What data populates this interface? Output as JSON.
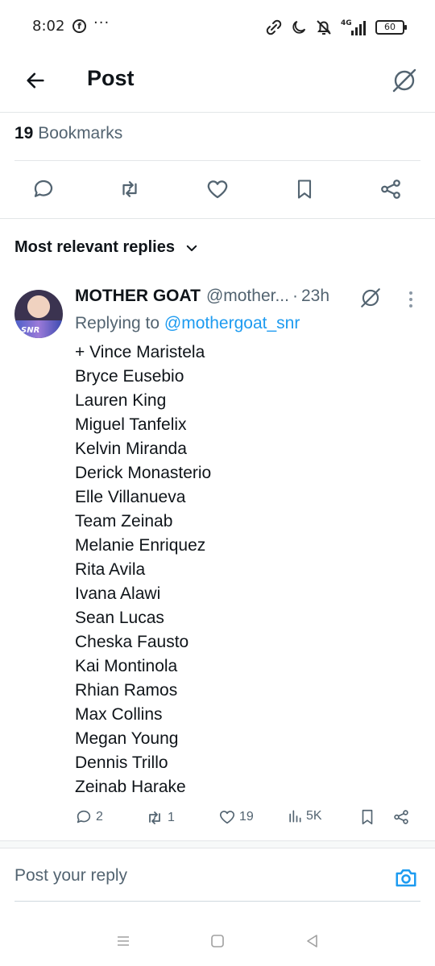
{
  "status_bar": {
    "time": "8:02",
    "facebook_glyph": "f",
    "more_dots": "···",
    "network_label": "4G",
    "battery": "60"
  },
  "header": {
    "title": "Post"
  },
  "post_stats": {
    "bookmark_count": "19",
    "bookmark_label": "Bookmarks"
  },
  "sort": {
    "label": "Most relevant replies"
  },
  "reply": {
    "display_name": "MOTHER GOAT",
    "handle": "@mother...",
    "dot": "·",
    "time": "23h",
    "replying_prefix": "Replying to",
    "replying_mention": "@mothergoat_snr",
    "avatar_text": "SNR",
    "lines": [
      "+ Vince Maristela",
      "Bryce Eusebio",
      "Lauren King",
      "Miguel Tanfelix",
      "Kelvin Miranda",
      "Derick Monasterio",
      "Elle Villanueva",
      "Team Zeinab",
      "Melanie Enriquez",
      "Rita Avila",
      "Ivana Alawi",
      "Sean Lucas",
      "Cheska Fausto",
      "Kai Montinola",
      "Rhian Ramos",
      "Max Collins",
      "Megan Young",
      "Dennis Trillo",
      "Zeinab Harake"
    ],
    "metrics": {
      "replies": "2",
      "reposts": "1",
      "likes": "19",
      "views": "5K"
    }
  },
  "compose": {
    "placeholder": "Post your reply"
  },
  "colors": {
    "accent": "#1d9bf0",
    "text_primary": "#0f1419",
    "text_secondary": "#536471",
    "divider": "#e3e6e8"
  }
}
